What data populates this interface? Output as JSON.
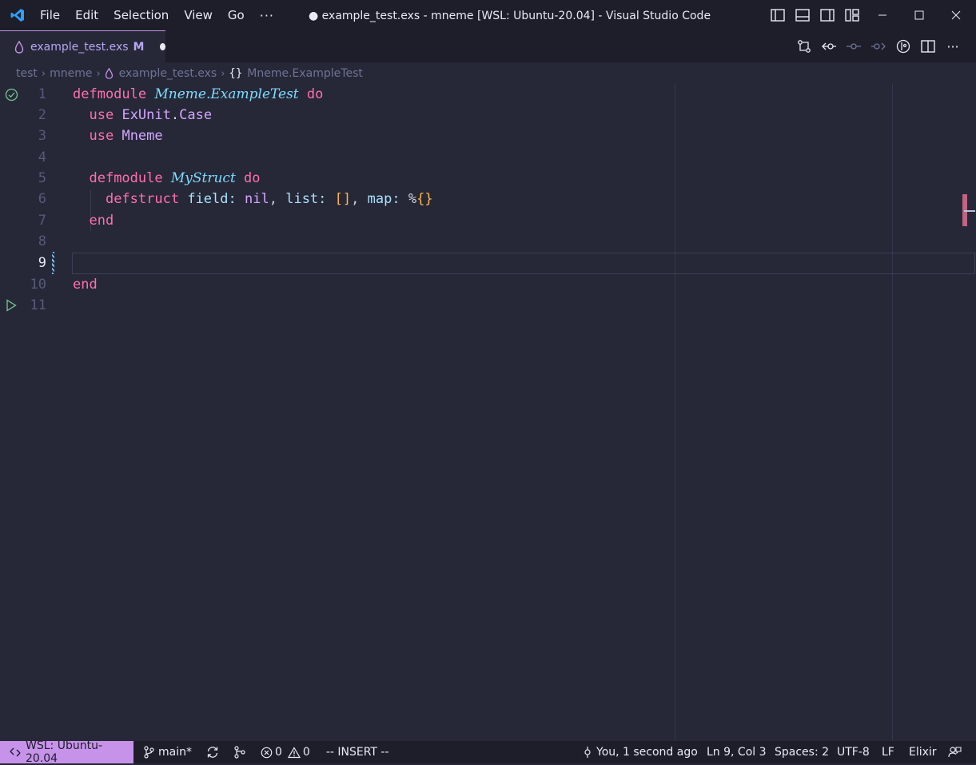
{
  "window": {
    "title": "● example_test.exs - mneme [WSL: Ubuntu-20.04] - Visual Studio Code",
    "menu": [
      "File",
      "Edit",
      "Selection",
      "View",
      "Go"
    ],
    "more": "···"
  },
  "tab": {
    "label": "example_test.exs",
    "modified_marker": "M"
  },
  "breadcrumb": {
    "segments": [
      "test",
      "mneme",
      "example_test.exs",
      "Mneme.ExampleTest"
    ],
    "symbol_glyph": "{}"
  },
  "editor": {
    "line_numbers": [
      "1",
      "2",
      "3",
      "4",
      "5",
      "6",
      "7",
      "8",
      "9",
      "10",
      "11"
    ],
    "current_line": "9",
    "code": {
      "l1": {
        "kw1": "defmodule",
        "mod": "Mneme.ExampleTest",
        "kw2": "do"
      },
      "l2": {
        "kw": "use",
        "alias1": "ExUnit",
        "dot": ".",
        "alias2": "Case"
      },
      "l3": {
        "kw": "use",
        "alias": "Mneme"
      },
      "l5": {
        "kw1": "defmodule",
        "mod": "MyStruct",
        "kw2": "do"
      },
      "l6": {
        "kw": "defstruct",
        "a1": "field:",
        "nil": "nil",
        "c1": ",",
        "a2": "list:",
        "b1": "[]",
        "c2": ",",
        "a3": "map:",
        "pct": "%",
        "b2": "{}"
      },
      "l7": {
        "kw": "end"
      },
      "l10": {
        "kw": "end"
      }
    }
  },
  "status": {
    "remote": "WSL: Ubuntu-20.04",
    "branch": "main*",
    "errors": "0",
    "warnings": "0",
    "mode": "-- INSERT --",
    "blame": "You, 1 second ago",
    "cursor": "Ln 9, Col 3",
    "spaces": "Spaces: 2",
    "encoding": "UTF-8",
    "eol": "LF",
    "language": "Elixir"
  },
  "colors": {
    "keyword": "#ff6fae",
    "module": "#7fdbff",
    "alias": "#d3a6ff",
    "bracket": "#ffb64a",
    "remote_bg": "#c792ea"
  }
}
